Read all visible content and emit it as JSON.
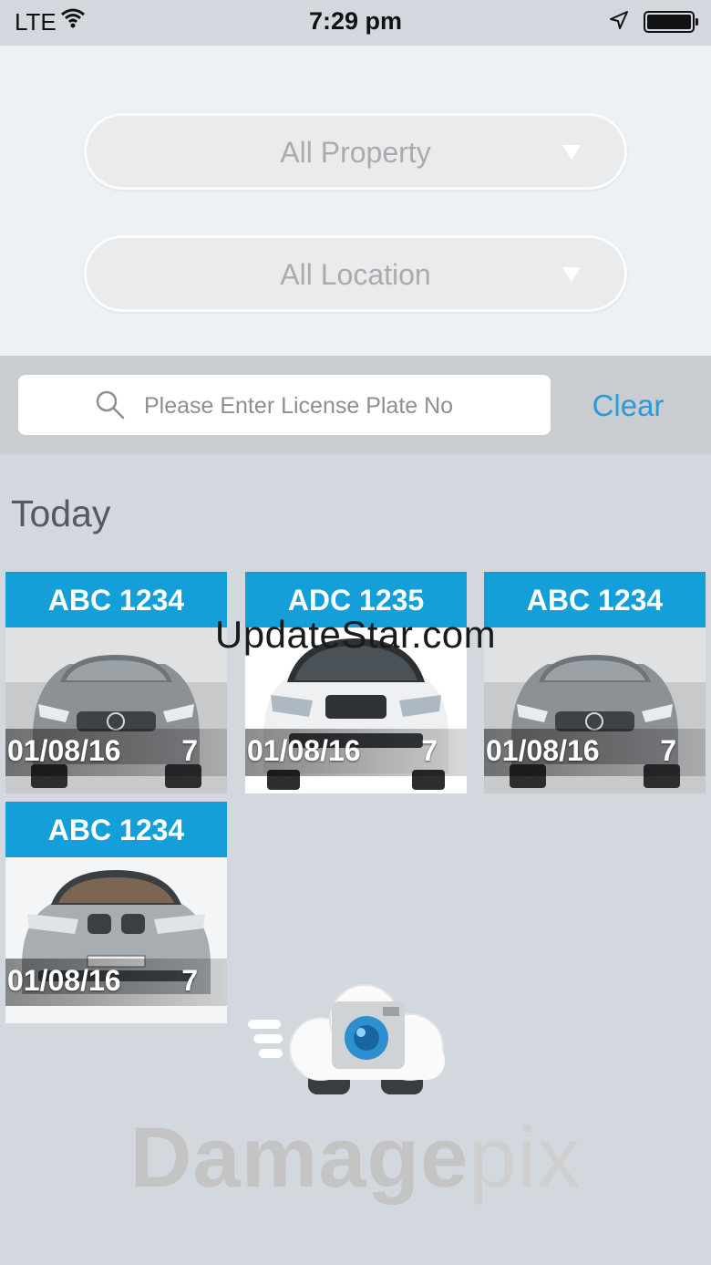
{
  "status_bar": {
    "carrier": "LTE",
    "time": "7:29 pm"
  },
  "filters": {
    "property": "All Property",
    "location": "All Location"
  },
  "search": {
    "placeholder": "Please Enter License Plate No",
    "value": "",
    "clear_label": "Clear"
  },
  "section_title": "Today",
  "cards": [
    {
      "plate": "ABC 1234",
      "date": "01/08/16",
      "count": "7",
      "car": "grey-sedan"
    },
    {
      "plate": "ADC 1235",
      "date": "01/08/16",
      "count": "7",
      "car": "white-suv"
    },
    {
      "plate": "ABC 1234",
      "date": "01/08/16",
      "count": "7",
      "car": "grey-sedan"
    },
    {
      "plate": "ABC 1234",
      "date": "01/08/16",
      "count": "7",
      "car": "silver-sedan"
    }
  ],
  "watermark": "UpdateStar.com",
  "brand": {
    "name_bold": "Damage",
    "name_light": "pix"
  },
  "colors": {
    "accent": "#159fd9",
    "link": "#2a9ad8",
    "background": "#d3d8de"
  }
}
